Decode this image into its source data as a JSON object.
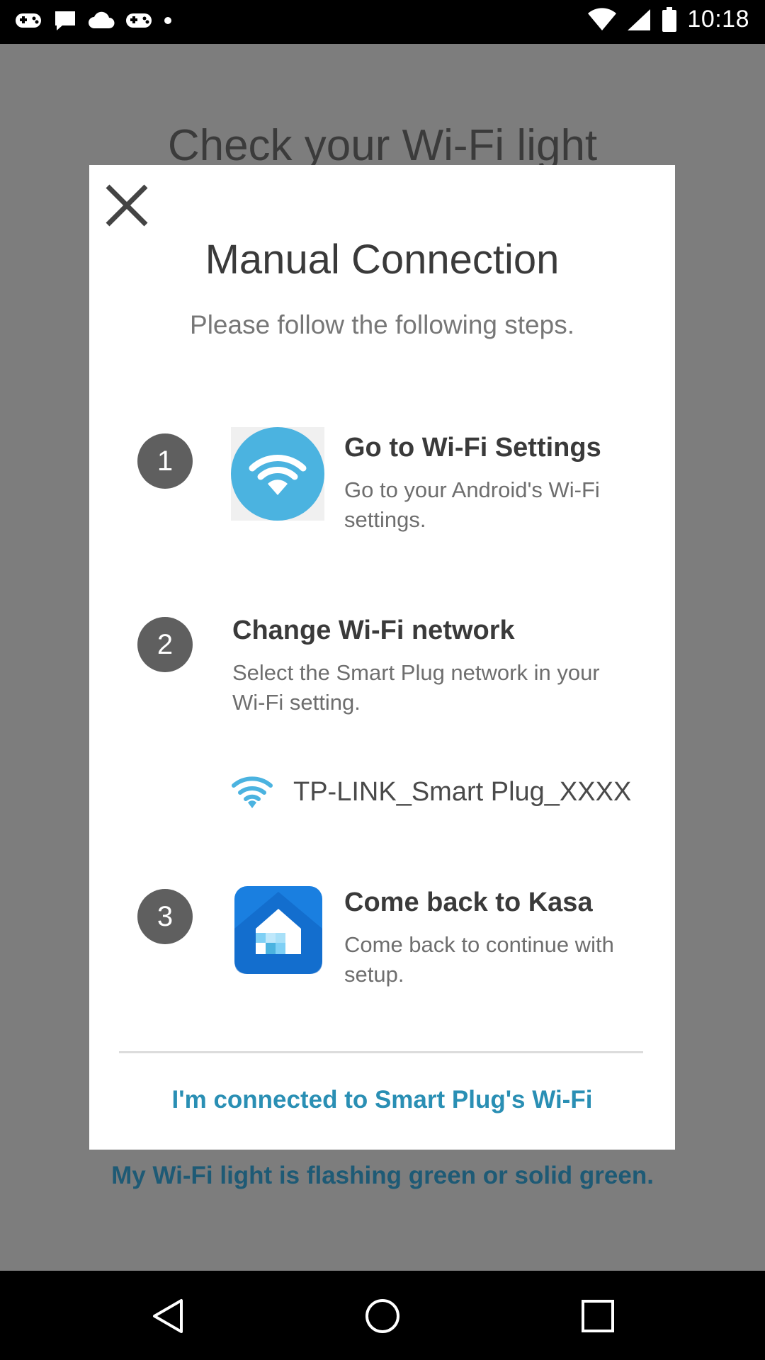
{
  "status_bar": {
    "time": "10:18",
    "left_icons": [
      "gamepad-icon",
      "chat-icon",
      "cloud-icon",
      "gamepad-icon",
      "dot-icon"
    ],
    "right_icons": [
      "wifi-signal-icon",
      "cellular-signal-icon",
      "battery-icon"
    ]
  },
  "background": {
    "title": "Check your Wi-Fi light",
    "link": "My Wi-Fi light is flashing green or solid green."
  },
  "dialog": {
    "title": "Manual Connection",
    "subtitle": "Please follow the following steps.",
    "steps": [
      {
        "number": "1",
        "icon": "wifi-icon",
        "title": "Go to Wi-Fi Settings",
        "description": "Go to your Android's Wi-Fi settings."
      },
      {
        "number": "2",
        "title": "Change Wi-Fi network",
        "description": "Select the Smart Plug network in your Wi-Fi setting."
      },
      {
        "number": "3",
        "icon": "kasa-app-icon",
        "title": "Come back to Kasa",
        "description": "Come back to continue with setup."
      }
    ],
    "network_example": "TP-LINK_Smart Plug_XXXX",
    "connected_button": "I'm connected to Smart Plug's Wi-Fi"
  },
  "colors": {
    "accent": "#2a8fb4",
    "wifi_icon_bg": "#4bb3e0",
    "kasa_blue": "#1a7fe0",
    "step_badge": "#5f5f5f"
  },
  "nav_bar": {
    "buttons": [
      "back-icon",
      "home-icon",
      "recents-icon"
    ]
  }
}
